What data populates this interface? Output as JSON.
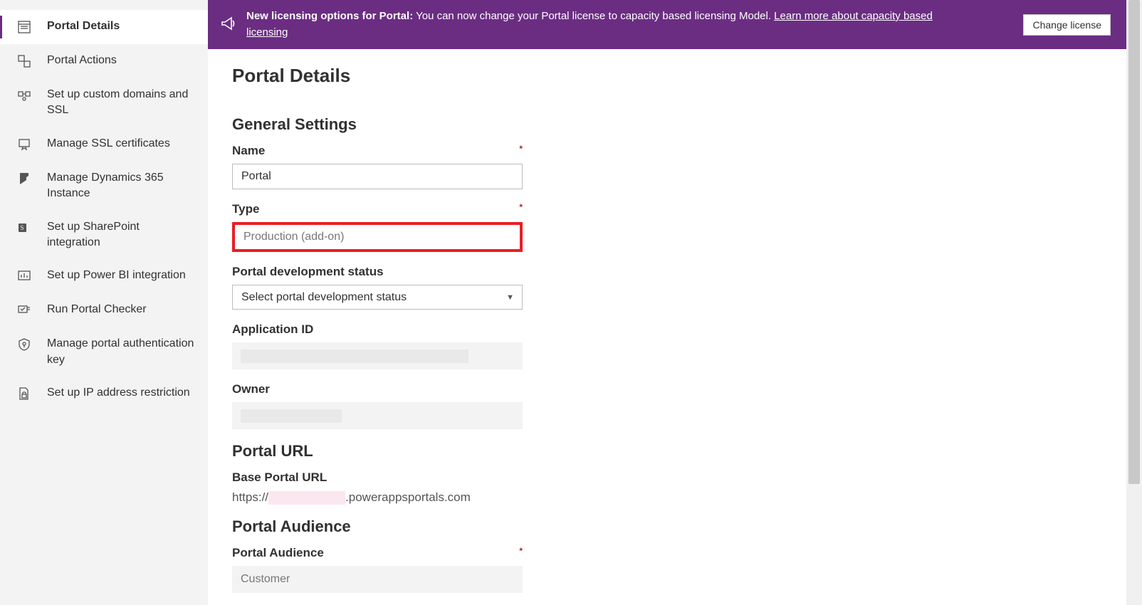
{
  "banner": {
    "bold": "New licensing options for Portal:",
    "text": " You can now change your Portal license to capacity based licensing Model. ",
    "link": "Learn more about capacity based licensing",
    "button": "Change license"
  },
  "sidebar": {
    "items": [
      {
        "label": "Portal Details"
      },
      {
        "label": "Portal Actions"
      },
      {
        "label": "Set up custom domains and SSL"
      },
      {
        "label": "Manage SSL certificates"
      },
      {
        "label": "Manage Dynamics 365 Instance"
      },
      {
        "label": "Set up SharePoint integration"
      },
      {
        "label": "Set up Power BI integration"
      },
      {
        "label": "Run Portal Checker"
      },
      {
        "label": "Manage portal authentication key"
      },
      {
        "label": "Set up IP address restriction"
      }
    ]
  },
  "page": {
    "title": "Portal Details",
    "sections": {
      "general": "General Settings",
      "url": "Portal URL",
      "audience": "Portal Audience"
    },
    "labels": {
      "name": "Name",
      "type": "Type",
      "devstatus": "Portal development status",
      "appid": "Application ID",
      "owner": "Owner",
      "baseurl": "Base Portal URL",
      "portal_audience": "Portal Audience",
      "required": "*"
    },
    "values": {
      "name": "Portal",
      "type": "Production (add-on)",
      "devstatus": "Select portal development status",
      "url_prefix": "https://",
      "url_suffix": ".powerappsportals.com",
      "audience": "Customer"
    }
  }
}
